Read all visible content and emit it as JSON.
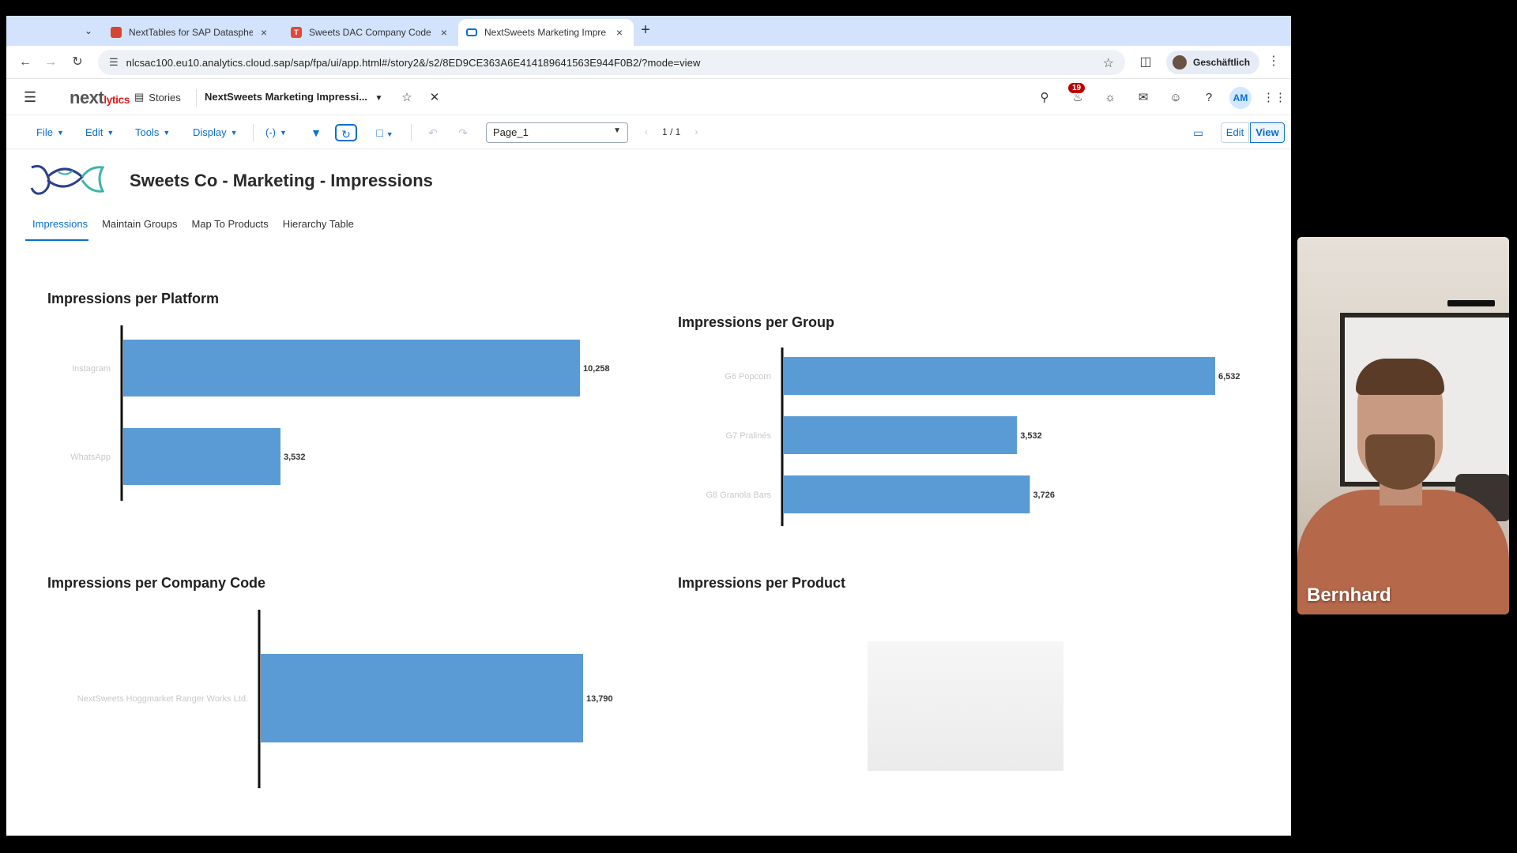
{
  "browser": {
    "tabs": [
      {
        "title": "NextTables for SAP Datasphe",
        "favicon_color": "#d64532"
      },
      {
        "title": "Sweets DAC Company Code",
        "favicon_color": "#e2463c"
      },
      {
        "title": "NextSweets Marketing Impre",
        "favicon_color": "#0a6ed1"
      }
    ],
    "url": "nlcsac100.eu10.analytics.cloud.sap/sap/fpa/ui/app.html#/story2&/s2/8ED9CE363A6E414189641563E944F0B2/?mode=view",
    "profile_label": "Geschäftlich"
  },
  "shell": {
    "logo_text": "next",
    "logo_accent": "lytics",
    "stories_label": "Stories",
    "story_title": "NextSweets Marketing Impressi...",
    "notification_count": "19",
    "user_initials": "AM"
  },
  "toolbar": {
    "menus": [
      "File",
      "Edit",
      "Tools",
      "Display"
    ],
    "formula_label": "(-)",
    "page_select": "Page_1",
    "pager": "1 / 1",
    "edit_label": "Edit",
    "view_label": "View"
  },
  "story": {
    "heading": "Sweets Co - Marketing - Impressions",
    "tabs": [
      "Impressions",
      "Maintain Groups",
      "Map To Products",
      "Hierarchy Table"
    ],
    "selected_tab": 0
  },
  "chart_data": [
    {
      "id": "platform",
      "type": "bar",
      "orientation": "horizontal",
      "title": "Impressions per Platform",
      "categories": [
        "Instagram",
        "WhatsApp"
      ],
      "values": [
        10258,
        3532
      ],
      "value_labels": [
        "10,258",
        "3,532"
      ],
      "xlim": [
        0,
        10258
      ],
      "color": "#5b9bd5"
    },
    {
      "id": "group",
      "type": "bar",
      "orientation": "horizontal",
      "title": "Impressions per Group",
      "categories": [
        "G6 Popcorn",
        "G7 Pralinés",
        "G8 Granola Bars"
      ],
      "values": [
        6532,
        3532,
        3726
      ],
      "value_labels": [
        "6,532",
        "3,532",
        "3,726"
      ],
      "xlim": [
        0,
        6532
      ],
      "color": "#5b9bd5"
    },
    {
      "id": "company",
      "type": "bar",
      "orientation": "horizontal",
      "title": "Impressions per Company Code",
      "categories": [
        "NextSweets Hoggmarket Ranger Works Ltd."
      ],
      "values": [
        13790
      ],
      "value_labels": [
        "13,790"
      ],
      "xlim": [
        0,
        13790
      ],
      "color": "#5b9bd5"
    },
    {
      "id": "product",
      "type": "bar",
      "title": "Impressions per Product",
      "categories": [],
      "values": []
    }
  ],
  "webcam": {
    "name": "Bernhard"
  }
}
